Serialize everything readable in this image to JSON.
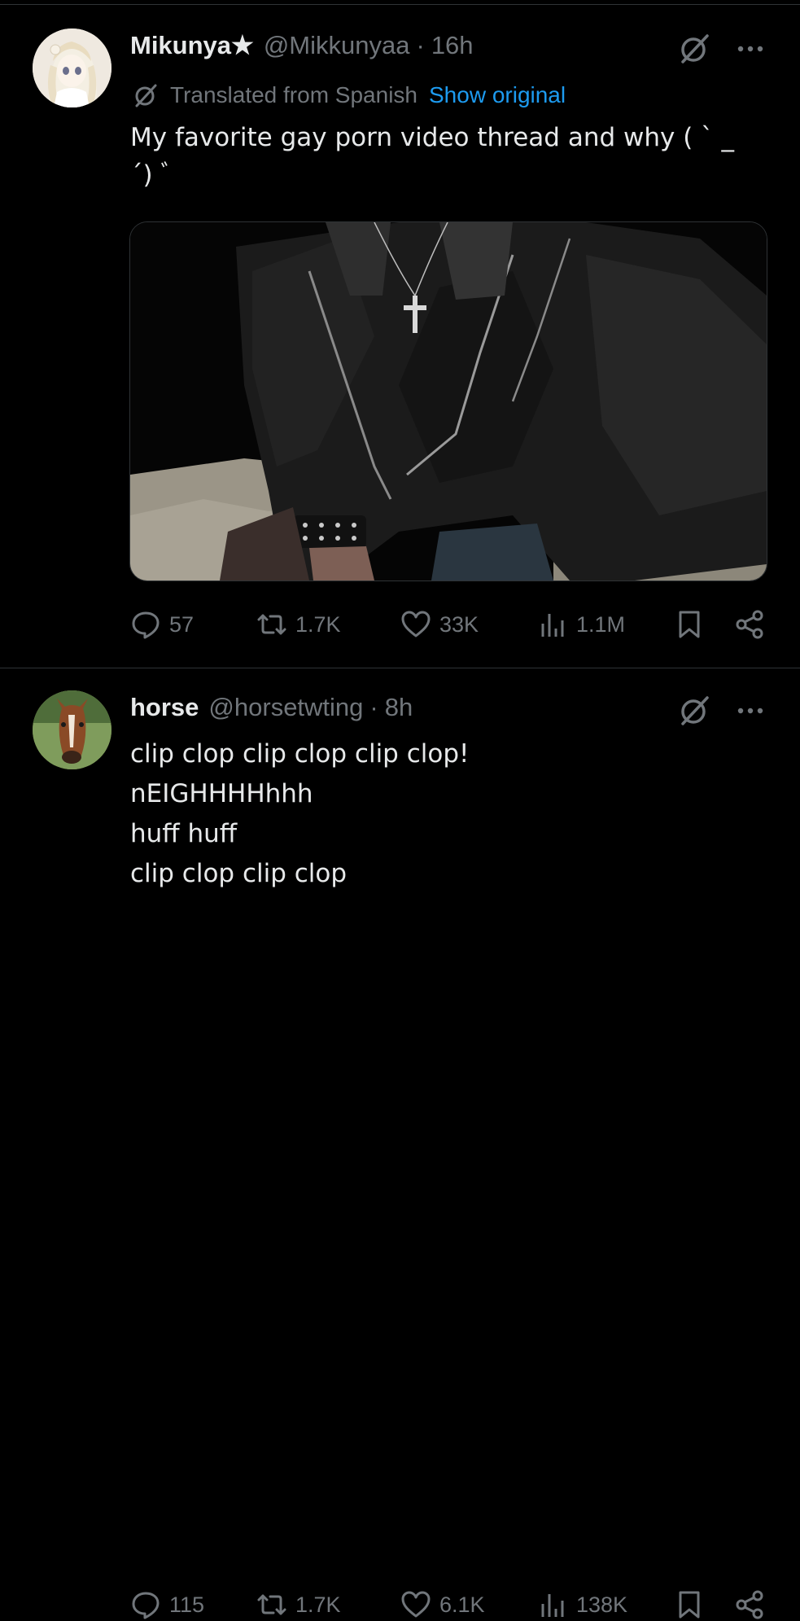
{
  "posts": [
    {
      "display_name": "Mikunya★",
      "handle": "@Mikkunyaa",
      "separator": "·",
      "time": "16h",
      "translated_label": "Translated from Spanish",
      "show_original": "Show original",
      "text": "My favorite gay porn video thread and why ( ` _\n´) ﾞ",
      "actions": {
        "replies": "57",
        "reposts": "1.7K",
        "likes": "33K",
        "views": "1.1M"
      }
    },
    {
      "display_name": "horse",
      "handle": "@horsetwting",
      "separator": "·",
      "time": "8h",
      "text": "clip clop clip clop clip clop!\nnEIGHHHHhhh\nhuff huff\nclip clop clip clop",
      "actions": {
        "replies": "115",
        "reposts": "1.7K",
        "likes": "6.1K",
        "views": "138K"
      }
    }
  ],
  "colors": {
    "background": "#000000",
    "text_primary": "#e7e9ea",
    "text_secondary": "#71767b",
    "link": "#1d9bf0",
    "divider": "#2f3336"
  },
  "icons": [
    "grok-icon",
    "more-icon",
    "translate-icon",
    "reply-icon",
    "repost-icon",
    "like-icon",
    "views-icon",
    "bookmark-icon",
    "share-icon"
  ]
}
